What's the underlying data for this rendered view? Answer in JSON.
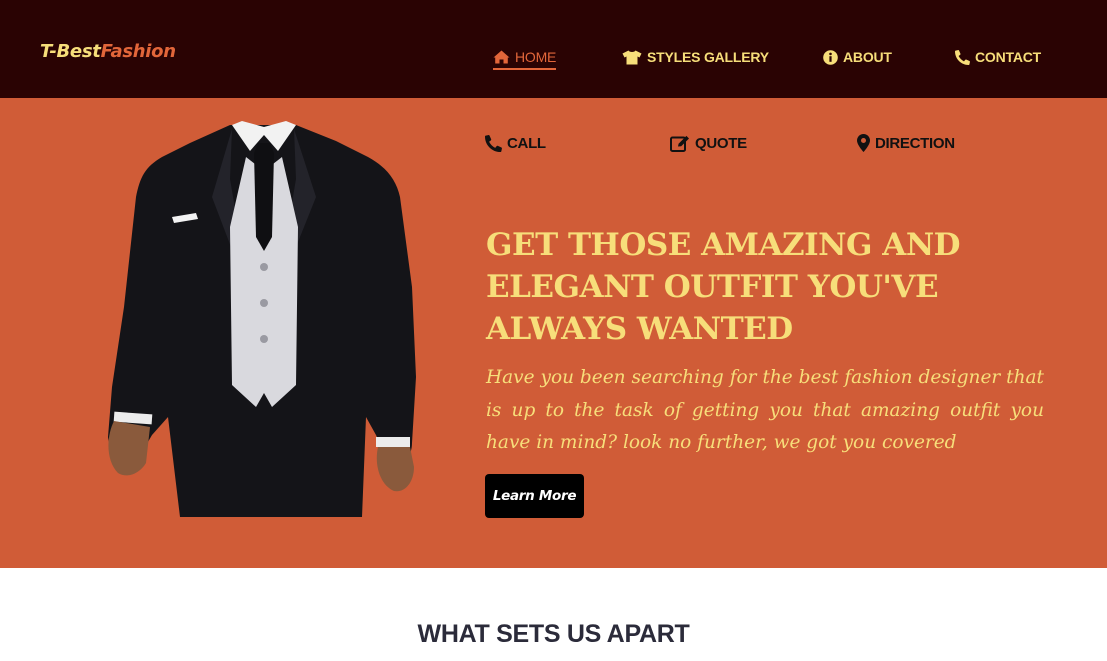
{
  "brand": {
    "part1": "T-Best",
    "part2": "Fashion"
  },
  "nav": {
    "home": {
      "label": "HOME",
      "icon": "home-icon"
    },
    "styles": {
      "label": "STYLES GALLERY",
      "icon": "tshirt-icon"
    },
    "about": {
      "label": "ABOUT",
      "icon": "info-circle-icon"
    },
    "contact": {
      "label": "CONTACT",
      "icon": "phone-icon"
    }
  },
  "actions": {
    "call": {
      "label": "CALL",
      "icon": "phone-icon"
    },
    "quote": {
      "label": "QUOTE",
      "icon": "edit-icon"
    },
    "direction": {
      "label": "DIRECTION",
      "icon": "map-marker-icon"
    }
  },
  "hero": {
    "headline": "GET THOSE AMAZING AND ELEGANT OUTFIT YOU'VE ALWAYS WANTED",
    "lead": "Have you been searching for the best fashion designer that is up to the task of getting you that amazing outfit you have in mind? look no further, we got you covered",
    "button": "Learn More"
  },
  "section": {
    "title": "WHAT SETS US APART"
  },
  "colors": {
    "navbar_bg": "#2a0303",
    "hero_bg": "#d05c37",
    "accent_yellow": "#f7de7a",
    "accent_orange": "#e2663a"
  }
}
